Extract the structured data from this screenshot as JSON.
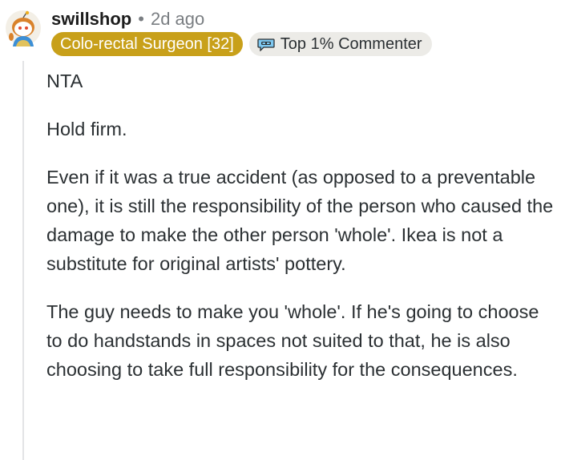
{
  "comment": {
    "username": "swillshop",
    "separator": "•",
    "timestamp": "2d ago",
    "flair": "Colo-rectal Surgeon [32]",
    "top_badge": {
      "label": "Top 1% Commenter",
      "icon": "top-commenter-icon"
    },
    "avatar_icon": "snoo-avatar",
    "paragraphs": [
      "NTA",
      "Hold firm.",
      "Even if it was a true accident (as opposed to a preventable one), it is still the responsibility of the person who caused the damage to make the other person 'whole'. Ikea is not a substitute for original artists' pottery.",
      "The guy needs to make you 'whole'. If he's going to choose to do handstands in spaces not suited to that, he is also choosing to take full responsibility for the consequences."
    ]
  },
  "colors": {
    "flair_bg": "#c8a01a",
    "badge_bg": "#ecebe7",
    "text": "#2b3033",
    "meta": "#7a7e82",
    "thread_line": "#e3e4e6"
  }
}
